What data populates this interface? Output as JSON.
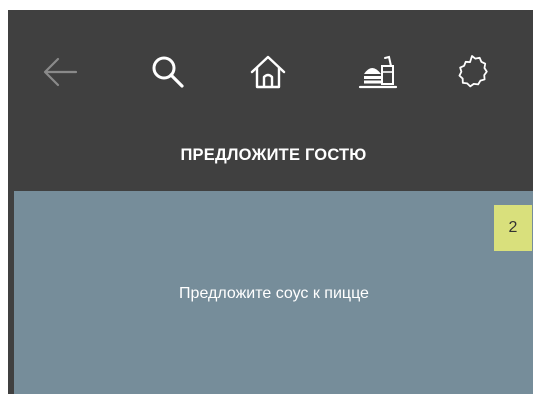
{
  "toolbar": {
    "icons": [
      {
        "name": "back-arrow-icon",
        "color": "#8a8a8a"
      },
      {
        "name": "search-icon",
        "color": "#ffffff"
      },
      {
        "name": "home-icon",
        "color": "#ffffff"
      },
      {
        "name": "burger-drink-icon",
        "color": "#ffffff"
      },
      {
        "name": "settings-cog-icon",
        "color": "#ffffff"
      }
    ]
  },
  "section": {
    "title": "ПРЕДЛОЖИТЕ ГОСТЮ"
  },
  "suggestion_card": {
    "badge": "2",
    "text": "Предложите соус к пицце",
    "background_color": "#768d9a",
    "badge_color": "#d9e07c"
  }
}
